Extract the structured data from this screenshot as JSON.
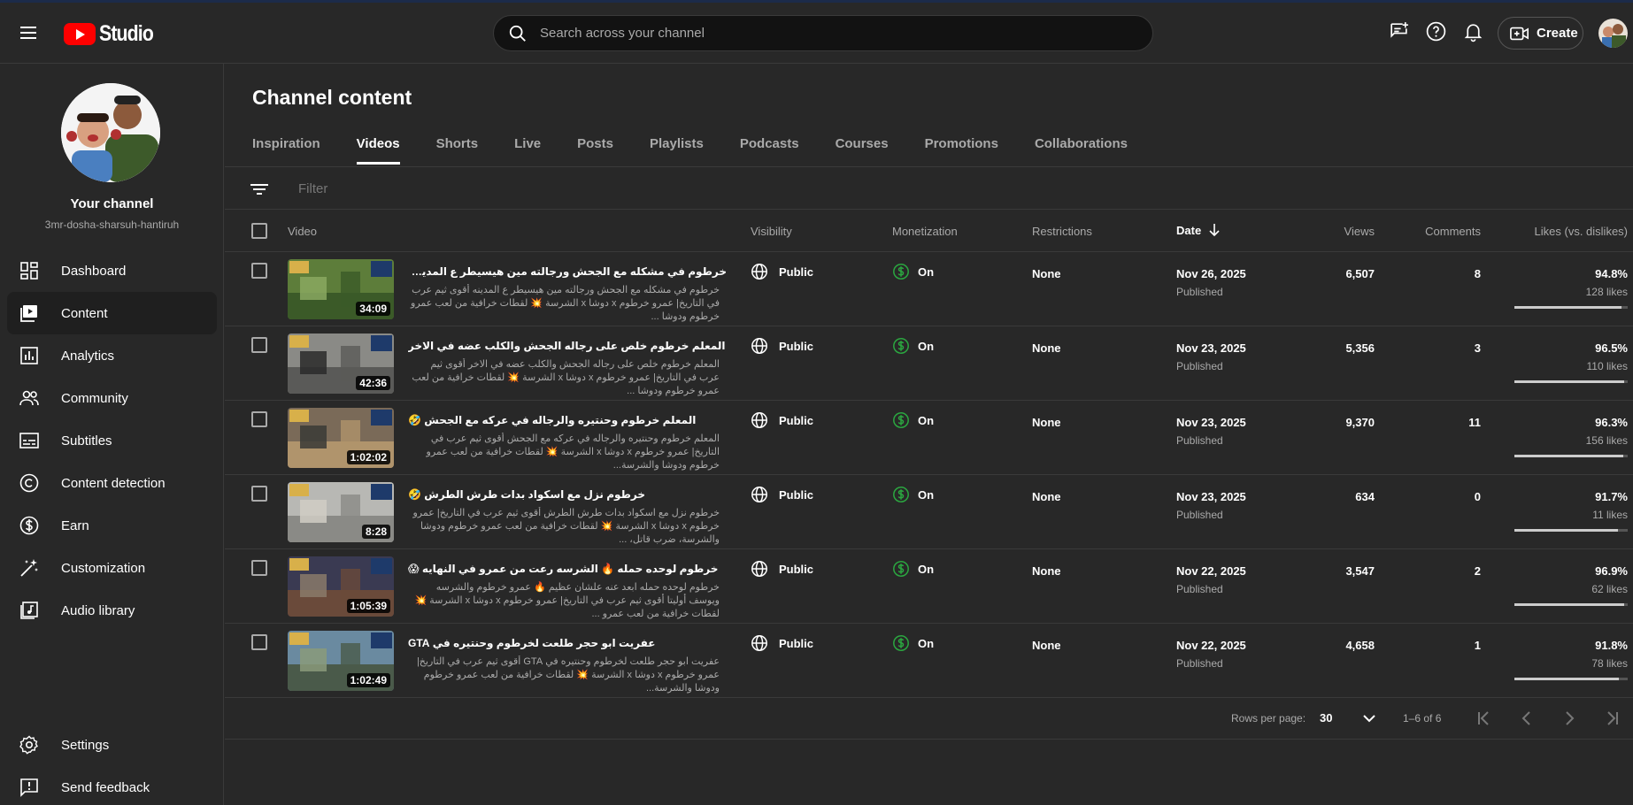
{
  "app": {
    "logo_text": "Studio"
  },
  "search": {
    "placeholder": "Search across your channel"
  },
  "header": {
    "create_label": "Create"
  },
  "sidebar": {
    "channel_title": "Your channel",
    "channel_handle": "3mr-dosha-sharsuh-hantiruh",
    "items": [
      {
        "label": "Dashboard",
        "icon": "dashboard-icon"
      },
      {
        "label": "Content",
        "icon": "content-icon",
        "active": true
      },
      {
        "label": "Analytics",
        "icon": "analytics-icon"
      },
      {
        "label": "Community",
        "icon": "community-icon"
      },
      {
        "label": "Subtitles",
        "icon": "subtitles-icon"
      },
      {
        "label": "Content detection",
        "icon": "copyright-icon"
      },
      {
        "label": "Earn",
        "icon": "earn-icon"
      },
      {
        "label": "Customization",
        "icon": "customization-icon"
      },
      {
        "label": "Audio library",
        "icon": "audio-library-icon"
      }
    ],
    "bottom_items": [
      {
        "label": "Settings",
        "icon": "gear-icon"
      },
      {
        "label": "Send feedback",
        "icon": "feedback-icon"
      }
    ]
  },
  "main": {
    "title": "Channel content",
    "tabs": [
      "Inspiration",
      "Videos",
      "Shorts",
      "Live",
      "Posts",
      "Playlists",
      "Podcasts",
      "Courses",
      "Promotions",
      "Collaborations"
    ],
    "active_tab": "Videos",
    "filter_placeholder": "Filter",
    "columns": {
      "video": "Video",
      "visibility": "Visibility",
      "monetization": "Monetization",
      "restrictions": "Restrictions",
      "date": "Date",
      "views": "Views",
      "comments": "Comments",
      "likes": "Likes (vs. dislikes)"
    },
    "rows": [
      {
        "title": "خرطوم في مشكله مع الجحش ورجالته مين هيسيطر ع المدينه ❔",
        "desc": "خرطوم في مشكله مع الجحش ورجالته مين هيسيطر ع المدينه أقوى ثيم عرب في التاريخ| عمرو خرطوم x دوشا x الشرسة 💥 لقطات خرافية من لعب عمرو خرطوم ودوشا ...",
        "duration": "34:09",
        "visibility": "Public",
        "monetization": "On",
        "restrictions": "None",
        "date": "Nov 26, 2025",
        "status": "Published",
        "views": "6,507",
        "comments": "8",
        "likes_pct": "94.8%",
        "likes_count": "128 likes",
        "likes_ratio": 0.948
      },
      {
        "title": "المعلم خرطوم خلص على رجاله الجحش والكلب عضه في الاخر",
        "desc": "المعلم خرطوم خلص على رجاله الجحش والكلب عضه في الاخر أقوى ثيم عرب في التاريخ| عمرو خرطوم x دوشا x الشرسة 💥 لقطات خرافية من لعب عمرو خرطوم ودوشا ...",
        "duration": "42:36",
        "visibility": "Public",
        "monetization": "On",
        "restrictions": "None",
        "date": "Nov 23, 2025",
        "status": "Published",
        "views": "5,356",
        "comments": "3",
        "likes_pct": "96.5%",
        "likes_count": "110 likes",
        "likes_ratio": 0.965
      },
      {
        "title": "المعلم خرطوم وحنتيره والرجاله في عركه مع الجحش 🤣",
        "desc": "المعلم خرطوم وحنتيره والرجاله في عركه مع الجحش أقوى ثيم عرب في التاريخ| عمرو خرطوم x دوشا x الشرسة 💥 لقطات خرافية من لعب عمرو خرطوم ودوشا والشرسة...",
        "duration": "1:02:02",
        "visibility": "Public",
        "monetization": "On",
        "restrictions": "None",
        "date": "Nov 23, 2025",
        "status": "Published",
        "views": "9,370",
        "comments": "11",
        "likes_pct": "96.3%",
        "likes_count": "156 likes",
        "likes_ratio": 0.963
      },
      {
        "title": "خرطوم نزل مع اسكواد بدات طرش الطرش 🤣",
        "desc": "خرطوم نزل مع اسكواد بدات طرش الطرش أقوى ثيم عرب في التاريخ| عمرو خرطوم x دوشا x الشرسة 💥 لقطات خرافية من لعب عمرو خرطوم ودوشا والشرسة، ضرب قاتل، ...",
        "duration": "8:28",
        "visibility": "Public",
        "monetization": "On",
        "restrictions": "None",
        "date": "Nov 23, 2025",
        "status": "Published",
        "views": "634",
        "comments": "0",
        "likes_pct": "91.7%",
        "likes_count": "11 likes",
        "likes_ratio": 0.917
      },
      {
        "title": "خرطوم لوحده حمله 🔥 الشرسه رعت من عمرو في النهايه 😱",
        "desc": "خرطوم لوحده حمله ابعد عنه علشان عظيم 🔥 عمرو خرطوم والشرسه ويوسف أوليتا أقوى ثيم عرب في التاريخ| عمرو خرطوم x دوشا x الشرسة 💥 لقطات خرافية من لعب عمرو ...",
        "duration": "1:05:39",
        "visibility": "Public",
        "monetization": "On",
        "restrictions": "None",
        "date": "Nov 22, 2025",
        "status": "Published",
        "views": "3,547",
        "comments": "2",
        "likes_pct": "96.9%",
        "likes_count": "62 likes",
        "likes_ratio": 0.969
      },
      {
        "title": "عفريت ابو حجر طلعت لخرطوم وحنتيره في GTA",
        "desc": "عفريت ابو حجر طلعت لخرطوم وحنتيره في GTA أقوى ثيم عرب في التاريخ| عمرو خرطوم x دوشا x الشرسة 💥 لقطات خرافية من لعب عمرو خرطوم ودوشا والشرسة...",
        "duration": "1:02:49",
        "visibility": "Public",
        "monetization": "On",
        "restrictions": "None",
        "date": "Nov 22, 2025",
        "status": "Published",
        "views": "4,658",
        "comments": "1",
        "likes_pct": "91.8%",
        "likes_count": "78 likes",
        "likes_ratio": 0.918
      }
    ],
    "pagination": {
      "rows_per_page_label": "Rows per page:",
      "rows_per_page_value": "30",
      "range": "1–6 of 6"
    }
  },
  "colors": {
    "background": "#282828",
    "brand_red": "#ff0000",
    "monetization_green": "#2ba640"
  }
}
